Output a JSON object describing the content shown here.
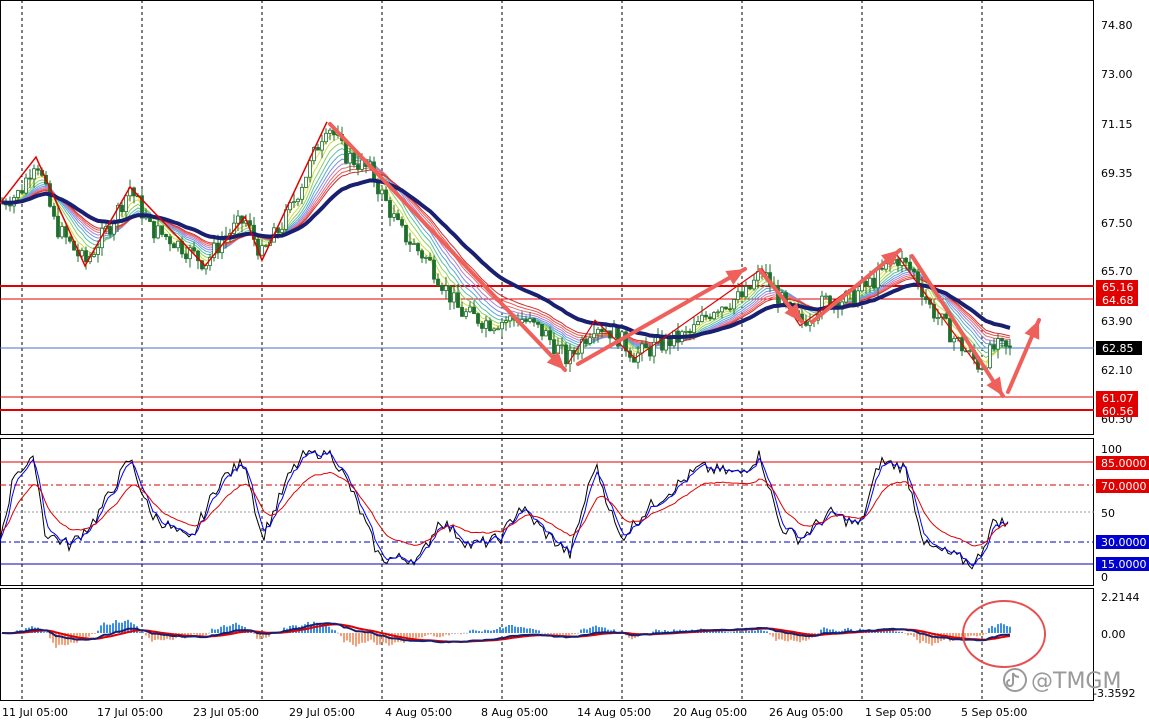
{
  "watermark": {
    "handle": "@TMGM",
    "icon": "tiktok-icon"
  },
  "colors": {
    "candle": "#1e6f2e",
    "ema_slow": "#1a2070",
    "level": "#e00000",
    "arrow": "#f0605a",
    "macd_pos": "#3a8ee6",
    "macd_neg": "#f2a07a",
    "stoch_k": "#000000",
    "stoch_d": "#0000ff",
    "rsi": "#e00000"
  },
  "price_axis": {
    "ticks": [
      "74.80",
      "73.00",
      "71.15",
      "69.35",
      "67.50",
      "65.70",
      "63.90",
      "62.10",
      "60.30"
    ]
  },
  "levels": {
    "upper_1": "65.16",
    "upper_2": "64.68",
    "current": "62.85",
    "lower_1": "61.07",
    "lower_2": "60.56"
  },
  "osc_axis": {
    "top": "100",
    "mid": "50",
    "bottom": "0",
    "l85": "85.0000",
    "l70": "70.0000",
    "l30": "30.0000",
    "l15": "15.0000"
  },
  "macd_axis": {
    "top": "2.2144",
    "zero": "0.00",
    "bottom": "-3.3592"
  },
  "time_axis": [
    "11 Jul 05:00",
    "17 Jul 05:00",
    "23 Jul 05:00",
    "29 Jul 05:00",
    "4 Aug 05:00",
    "8 Aug 05:00",
    "14 Aug 05:00",
    "20 Aug 05:00",
    "26 Aug 05:00",
    "1 Sep 05:00",
    "5 Sep 05:00"
  ],
  "chart_data": {
    "type": "line",
    "title": "",
    "x": [
      "11 Jul 05:00",
      "17 Jul 05:00",
      "23 Jul 05:00",
      "29 Jul 05:00",
      "4 Aug 05:00",
      "8 Aug 05:00",
      "14 Aug 05:00",
      "20 Aug 05:00",
      "26 Aug 05:00",
      "1 Sep 05:00",
      "5 Sep 05:00"
    ],
    "ylim": [
      60.3,
      74.8
    ],
    "series": [
      {
        "values": [
          68.2,
          67.4,
          66.8,
          67.6,
          69.6,
          64.6,
          63.0,
          64.4,
          64.7,
          65.6,
          62.8
        ]
      }
    ],
    "horizontal_levels": [
      65.16,
      64.68,
      62.85,
      61.07,
      60.56
    ]
  }
}
